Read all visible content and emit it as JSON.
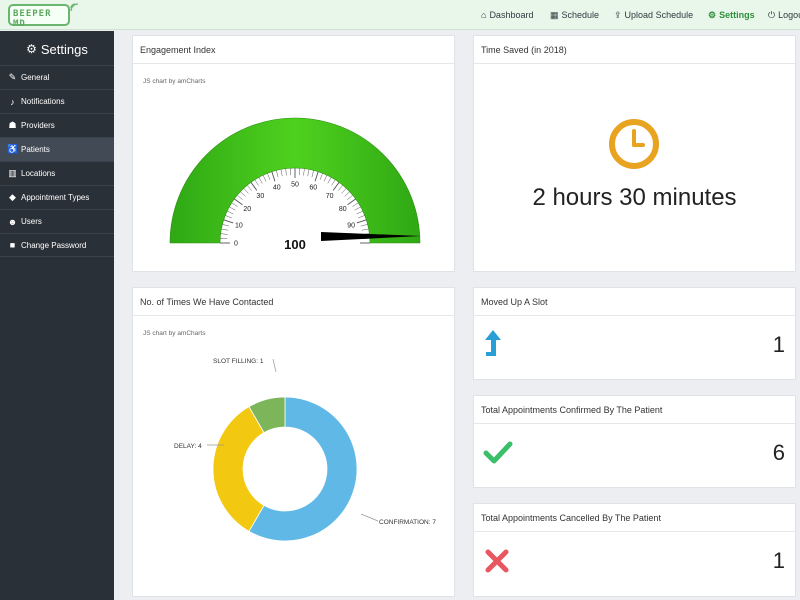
{
  "brand": {
    "logo_text": "BEEPER MD"
  },
  "nav": [
    {
      "label": "Dashboard",
      "icon": "home-icon"
    },
    {
      "label": "Schedule",
      "icon": "calendar-icon"
    },
    {
      "label": "Upload Schedule",
      "icon": "upload-icon"
    },
    {
      "label": "Settings",
      "icon": "gears-icon",
      "active": true
    },
    {
      "label": "Logout",
      "icon": "power-icon"
    }
  ],
  "sidebar": {
    "title": "Settings",
    "items": [
      {
        "label": "General",
        "icon": "wrench-icon"
      },
      {
        "label": "Notifications",
        "icon": "bell-icon"
      },
      {
        "label": "Providers",
        "icon": "provider-icon"
      },
      {
        "label": "Patients",
        "icon": "wheelchair-icon",
        "active": true
      },
      {
        "label": "Locations",
        "icon": "map-icon"
      },
      {
        "label": "Appointment Types",
        "icon": "tag-icon"
      },
      {
        "label": "Users",
        "icon": "users-icon"
      },
      {
        "label": "Change Password",
        "icon": "lock-icon"
      }
    ]
  },
  "engagement": {
    "title": "Engagement Index",
    "credit": "JS chart by amCharts",
    "value": "100",
    "ticks": [
      "0",
      "10",
      "20",
      "30",
      "40",
      "50",
      "60",
      "70",
      "80",
      "90"
    ],
    "colors": {
      "band": "#3ec21a",
      "needle": "#000000"
    }
  },
  "time_saved": {
    "title": "Time Saved (in 2018)",
    "value": "2 hours 30 minutes",
    "icon": "clock-icon",
    "color": "#e8a321"
  },
  "contacted": {
    "title": "No. of Times We Have Contacted",
    "credit": "JS chart by amCharts",
    "labels": {
      "slot_filling": "SLOT FILLING: 1",
      "delay": "DELAY: 4",
      "confirmation": "CONFIRMATION: 7"
    }
  },
  "chart_data": {
    "type": "pie",
    "donut": true,
    "categories": [
      "CONFIRMATION",
      "DELAY",
      "SLOT FILLING"
    ],
    "values": [
      7,
      4,
      1
    ],
    "colors": [
      "#5fb8e6",
      "#f2c811",
      "#7db55a"
    ]
  },
  "moved_up": {
    "title": "Moved Up A Slot",
    "value": "1",
    "icon": "arrow-up-icon",
    "color": "#2a9fd6"
  },
  "confirmed": {
    "title": "Total Appointments Confirmed By The Patient",
    "value": "6",
    "icon": "check-icon",
    "color": "#3cbf6a"
  },
  "cancelled": {
    "title": "Total Appointments Cancelled By The Patient",
    "value": "1",
    "icon": "cross-icon",
    "color": "#e8565f"
  }
}
